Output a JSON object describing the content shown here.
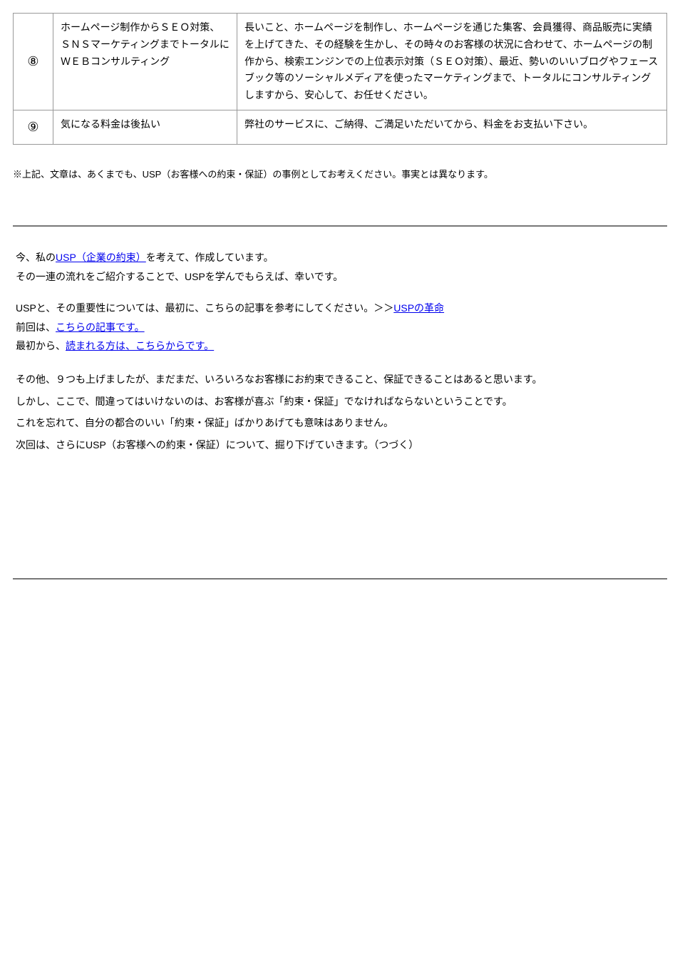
{
  "table": {
    "rows": [
      {
        "num": "⑧",
        "col2": "ホームページ制作からＳＥＯ対策、ＳＮＳマーケティングまでトータルにＷＥＢコンサルティング",
        "col3_lines": [
          "長いこと、ホームページを制作し、ホームページを通じた集客、会員獲得、商品販売に実績を上げてきた、その経験を生かし、その時々のお客様の状況に合わせて、ホームページの制作から、検索エンジンでの上位表示対策（ＳＥＯ対策）、最近、勢いのいいブログやフェースブック等のソーシャルメディアを使ったマーケティングまで、トータルにコンサルティングしますから、安心して、お任せください。"
        ]
      },
      {
        "num": "⑨",
        "col2": "気になる料金は後払い",
        "col3_lines": [
          "弊社のサービスに、ご納得、ご満足いただいてから、料金をお支払い下さい。"
        ]
      }
    ]
  },
  "note": "※上記、文章は、あくまでも、USP（お客様への約束・保証）の事例としてお考えください。事実とは異なります。",
  "prefatory": {
    "line1_prefix": "今、私の",
    "line1_link": "USP（企業の約束）",
    "line1_suffix": "を考えて、作成しています。",
    "line2": "その一連の流れをご紹介することで、USPを学んでもらえば、幸いです。"
  },
  "links": {
    "l1_prefix": "USPと、その重要性については、最初に、こちらの記事を参考にしてください。＞＞",
    "l1_link": "USPの革命",
    "l2_prefix": "前回は、",
    "l2_link": "こちらの記事です。",
    "l3_prefix": "最初から、",
    "l3_link": "読まれる方は、こちらからです。"
  },
  "body": {
    "p1": "その他、９つも上げましたが、まだまだ、いろいろなお客様にお約束できること、保証できることはあると思います。",
    "p2": "しかし、ここで、間違ってはいけないのは、お客様が喜ぶ「約束・保証」でなければならないということです。",
    "p3": "これを忘れて、自分の都合のいい「約束・保証」ばかりあげても意味はありません。",
    "p4": "次回は、さらにUSP（お客様への約束・保証）について、掘り下げていきます。（つづく）"
  }
}
